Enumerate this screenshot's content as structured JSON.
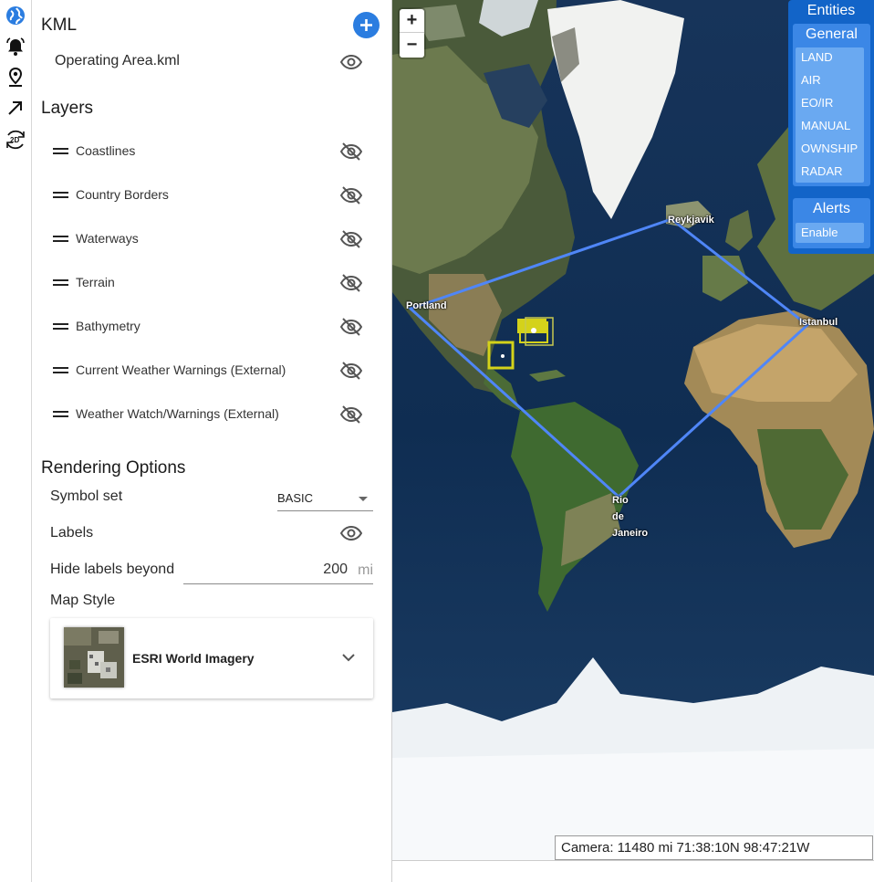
{
  "rail": {
    "icons": [
      "globe-icon",
      "alarm-bell-icon",
      "map-pin-icon",
      "arrow-diagonal-icon",
      "rotate-2d-icon"
    ],
    "view_mode": "2D"
  },
  "kml": {
    "title": "KML",
    "file": "Operating Area.kml"
  },
  "layers": {
    "title": "Layers",
    "items": [
      {
        "label": "Coastlines",
        "visible": false
      },
      {
        "label": "Country Borders",
        "visible": false
      },
      {
        "label": "Waterways",
        "visible": false
      },
      {
        "label": "Terrain",
        "visible": false
      },
      {
        "label": "Bathymetry",
        "visible": false
      },
      {
        "label": "Current Weather Warnings (External)",
        "visible": false
      },
      {
        "label": "Weather Watch/Warnings (External)",
        "visible": false
      }
    ]
  },
  "rendering": {
    "title": "Rendering Options",
    "symbol_set_label": "Symbol set",
    "symbol_set_value": "BASIC",
    "labels_label": "Labels",
    "hide_labels_label": "Hide labels beyond",
    "hide_labels_value": "200",
    "hide_labels_unit": "mi",
    "map_style_label": "Map Style",
    "map_style_value": "ESRI World Imagery"
  },
  "map": {
    "zoom_in": "+",
    "zoom_out": "−",
    "cities": {
      "reykjavik": "Reykjavik",
      "portland": "Portland",
      "istanbul": "Istanbul",
      "rio": [
        "Rio",
        "de",
        "Janeiro"
      ]
    },
    "polygon_color": "#4f86f7",
    "track_color": "#d4d21a"
  },
  "entities": {
    "title": "Entities",
    "general_title": "General",
    "general_items": [
      "LAND",
      "AIR",
      "EO/IR",
      "MANUAL",
      "OWNSHIP",
      "RADAR"
    ],
    "alerts_title": "Alerts",
    "alerts_item": "Enable",
    "panel_color": "#1264c8"
  },
  "camera": {
    "text": "Camera: 11480 mi 71:38:10N 98:47:21W"
  }
}
